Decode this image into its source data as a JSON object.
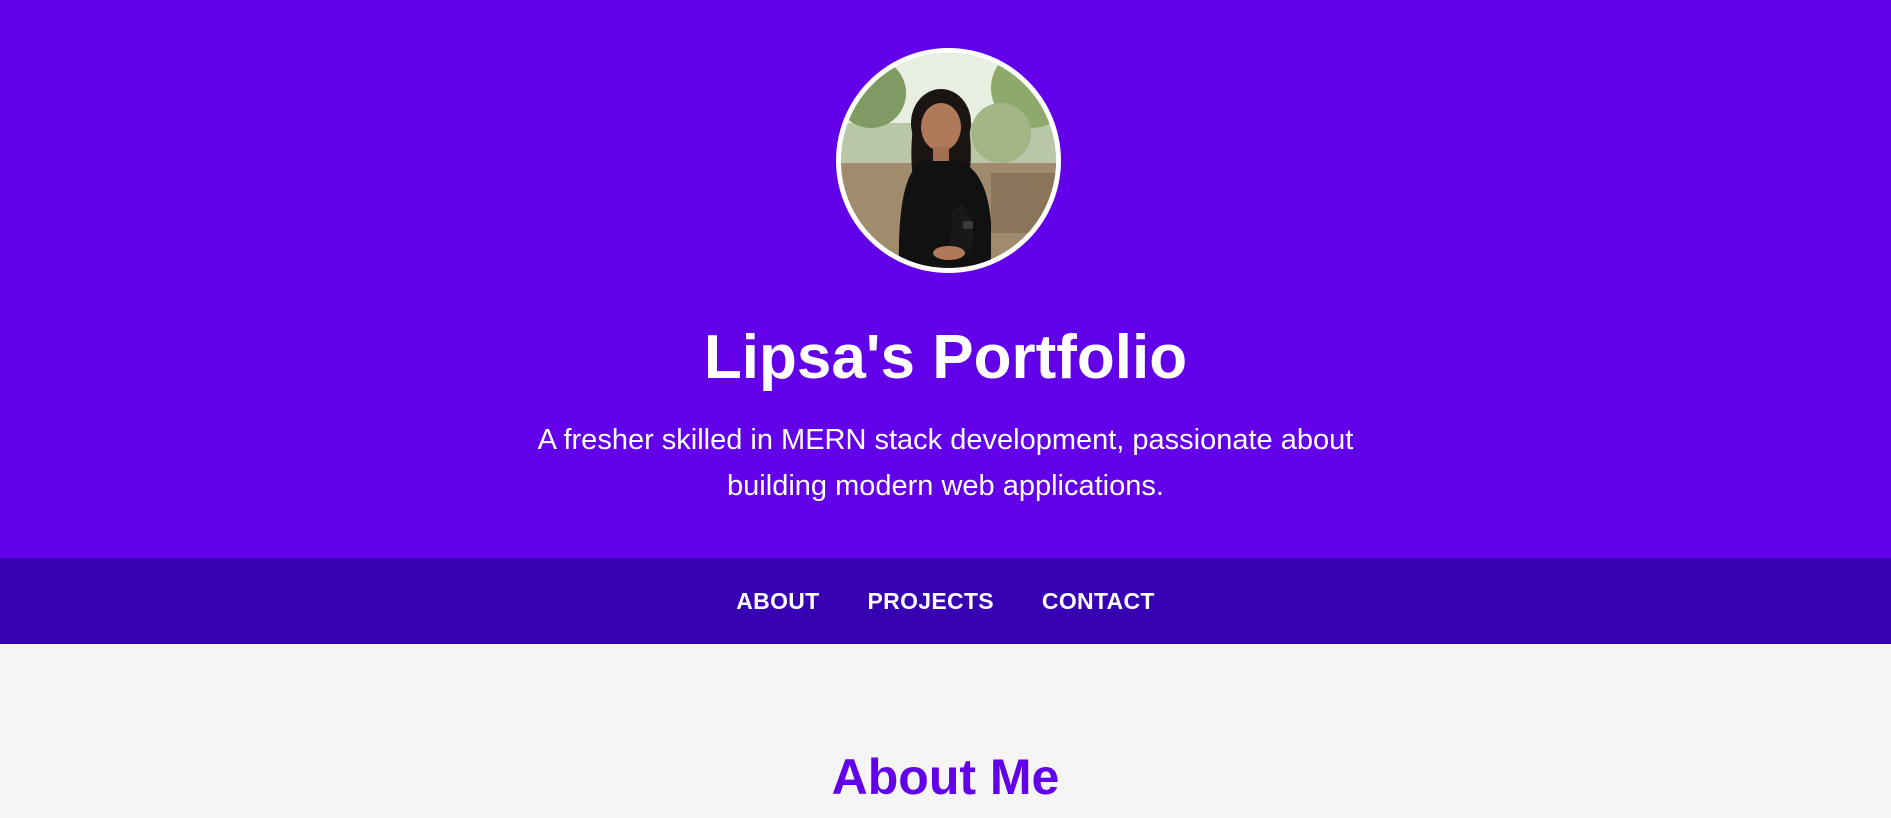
{
  "hero": {
    "title": "Lipsa's Portfolio",
    "tagline": "A fresher skilled in MERN stack development, passionate about building modern web applications.",
    "background_color": "#6200ea",
    "avatar_icon": "profile-photo"
  },
  "nav": {
    "background_color": "#3700b3",
    "items": [
      {
        "label": "ABOUT"
      },
      {
        "label": "PROJECTS"
      },
      {
        "label": "CONTACT"
      }
    ]
  },
  "about": {
    "heading": "About Me",
    "heading_color": "#6200ea"
  }
}
